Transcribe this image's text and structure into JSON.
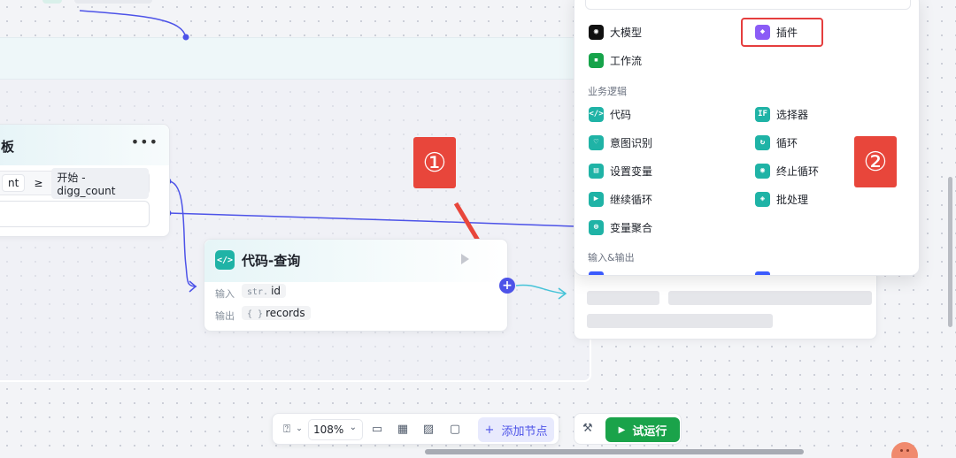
{
  "canvas": {
    "left_card": {
      "title_fragment": "板",
      "param_value": "nt",
      "operator": "≥",
      "param_ref": "开始 - digg_count"
    },
    "code_node": {
      "title": "代码-查询",
      "input_label": "输入",
      "input_type": "str.",
      "input_name": "id",
      "output_label": "输出",
      "output_type": "{ }",
      "output_name": "records"
    }
  },
  "node_menu": {
    "items_top": [
      {
        "label": "大模型",
        "icon": "llm-icon"
      },
      {
        "label": "插件",
        "icon": "plugin-icon"
      },
      {
        "label": "工作流",
        "icon": "workflow-icon"
      }
    ],
    "section_logic": "业务逻辑",
    "logic_items": [
      {
        "label": "代码",
        "icon": "code-icon"
      },
      {
        "label": "选择器",
        "icon": "if-icon"
      },
      {
        "label": "意图识别",
        "icon": "intent-icon"
      },
      {
        "label": "循环",
        "icon": "loop-icon"
      },
      {
        "label": "设置变量",
        "icon": "set-variable-icon"
      },
      {
        "label": "终止循环",
        "icon": "stop-loop-icon"
      },
      {
        "label": "继续循环",
        "icon": "continue-loop-icon"
      },
      {
        "label": "批处理",
        "icon": "batch-icon"
      },
      {
        "label": "变量聚合",
        "icon": "variable-merge-icon"
      }
    ],
    "section_io": "输入&输出"
  },
  "annotations": {
    "step1": "①",
    "step2": "②",
    "color": "#e8463b"
  },
  "toolbar": {
    "zoom": "108%",
    "add_node": "添加节点",
    "run": "试运行"
  },
  "colors": {
    "accent": "#4d53e8",
    "run_green": "#1aa34a",
    "node_teal": "#1fb3a6",
    "highlight_red": "#e53e3e"
  }
}
